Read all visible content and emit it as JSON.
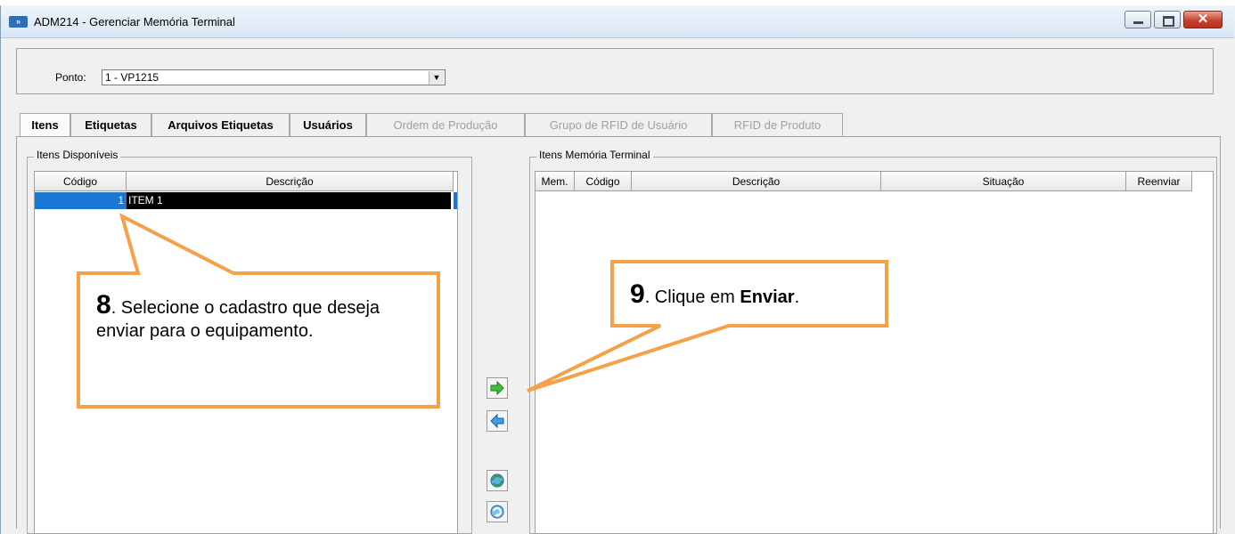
{
  "window": {
    "title": "ADM214 - Gerenciar Memória Terminal",
    "icon": "app-icon",
    "close_glyph": "✕"
  },
  "ponto": {
    "label": "Ponto:",
    "value": "1 - VP1215"
  },
  "tabs": [
    {
      "label": "Itens",
      "active": true,
      "enabled": true
    },
    {
      "label": "Etiquetas",
      "enabled": true
    },
    {
      "label": "Arquivos Etiquetas",
      "enabled": true
    },
    {
      "label": "Usuários",
      "enabled": true
    },
    {
      "label": "Ordem de Produção",
      "enabled": false
    },
    {
      "label": "Grupo de RFID de Usuário",
      "enabled": false
    },
    {
      "label": "RFID de Produto",
      "enabled": false
    }
  ],
  "available": {
    "title": "Itens Disponíveis",
    "columns": [
      "Código",
      "Descrição"
    ],
    "rows": [
      {
        "codigo": "1",
        "descricao": "ITEM 1",
        "selected": true
      }
    ]
  },
  "terminal": {
    "title": "Itens Memória Terminal",
    "columns": [
      "Mem.",
      "Código",
      "Descrição",
      "Situação",
      "Reenviar"
    ],
    "rows": []
  },
  "buttons": [
    {
      "name": "send-right-button",
      "icon": "arrow-right-icon"
    },
    {
      "name": "send-left-button",
      "icon": "arrow-left-icon"
    },
    {
      "name": "refresh-button",
      "icon": "refresh-icon"
    },
    {
      "name": "resend-button",
      "icon": "resend-icon"
    }
  ],
  "callouts": {
    "step8": {
      "number": "8",
      "text": ". Selecione o cadastro que deseja enviar para o equipamento."
    },
    "step9": {
      "number": "9",
      "text_before": ". Clique em ",
      "bold": "Enviar",
      "text_after": "."
    }
  },
  "colors": {
    "callout_border": "#f4a14a",
    "selection_blue": "#1976d2",
    "close_red": "#c4442e"
  }
}
